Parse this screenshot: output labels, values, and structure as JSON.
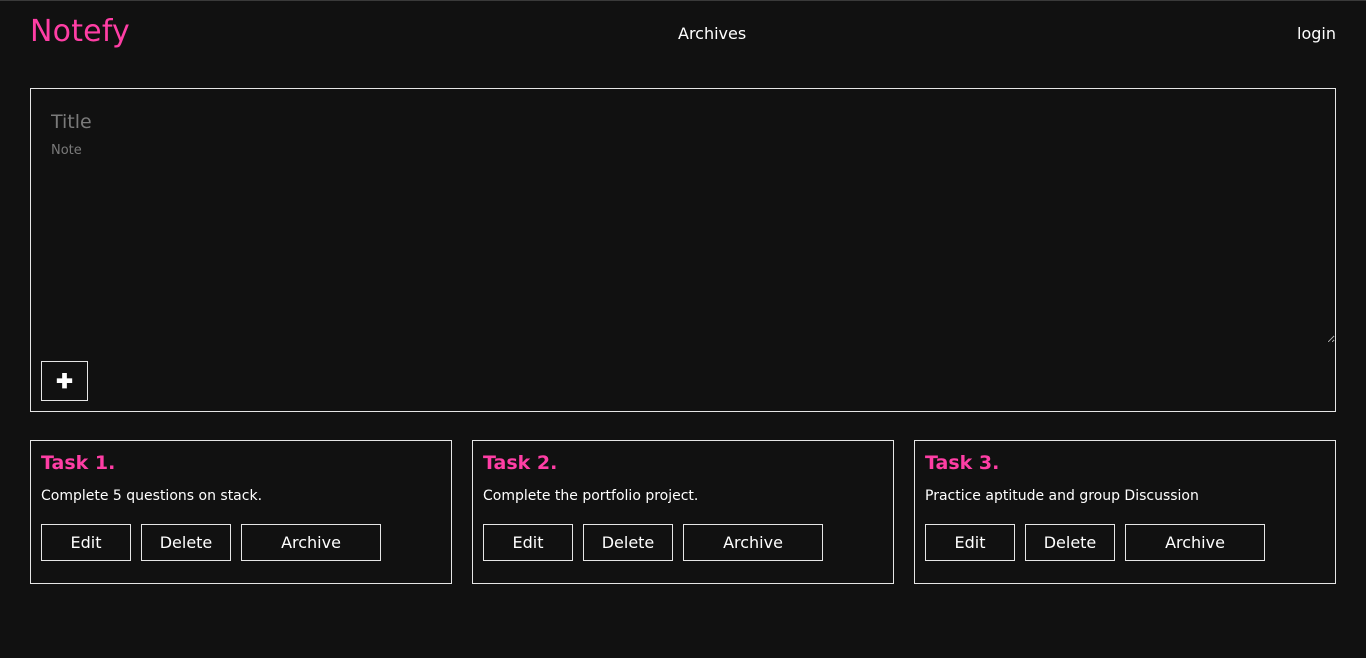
{
  "brand": {
    "name": "Notefy",
    "color": "#ff3ea5"
  },
  "nav": {
    "archives": "Archives",
    "login": "login"
  },
  "composer": {
    "title_placeholder": "Title",
    "note_placeholder": "Note",
    "add_icon": "plus-icon",
    "add_label": "✚"
  },
  "cards": [
    {
      "title": "Task 1.",
      "text": "Complete 5 questions on stack.",
      "edit": "Edit",
      "delete": "Delete",
      "archive": "Archive"
    },
    {
      "title": "Task 2.",
      "text": "Complete the portfolio project.",
      "edit": "Edit",
      "delete": "Delete",
      "archive": "Archive"
    },
    {
      "title": "Task 3.",
      "text": "Practice aptitude and group Discussion",
      "edit": "Edit",
      "delete": "Delete",
      "archive": "Archive"
    }
  ]
}
